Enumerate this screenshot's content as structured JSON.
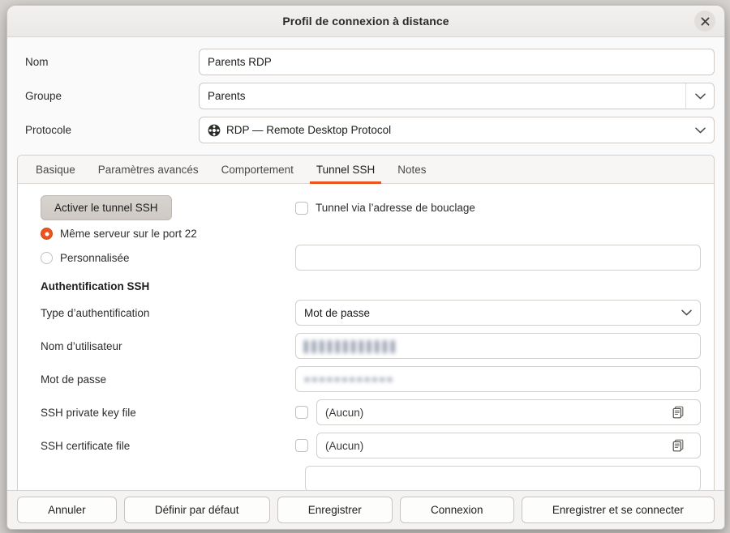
{
  "window": {
    "title": "Profil de connexion à distance",
    "close_icon": "close-icon"
  },
  "accent_color": "#e95420",
  "top_form": {
    "rows": [
      {
        "label": "Nom",
        "value": "Parents RDP",
        "kind": "entry"
      },
      {
        "label": "Groupe",
        "value": "Parents",
        "kind": "combo"
      },
      {
        "label": "Protocole",
        "value": "RDP — Remote Desktop Protocol",
        "kind": "combo",
        "icon": "rdp-protocol-icon"
      }
    ]
  },
  "tabs": [
    {
      "label": "Basique",
      "active": false
    },
    {
      "label": "Paramètres avancés",
      "active": false
    },
    {
      "label": "Comportement",
      "active": false
    },
    {
      "label": "Tunnel SSH",
      "active": true
    },
    {
      "label": "Notes",
      "active": false
    }
  ],
  "ssh_tunnel": {
    "enable_button": "Activer le tunnel SSH",
    "loopback_checkbox": {
      "label": "Tunnel via l’adresse de bouclage",
      "checked": false
    },
    "server_choice": [
      {
        "label": "Même serveur sur le port 22",
        "selected": true
      },
      {
        "label": "Personnalisée",
        "selected": false
      }
    ],
    "custom_server_value": "",
    "auth_section_title": "Authentification SSH",
    "auth_type": {
      "label": "Type d’authentification",
      "value": "Mot de passe"
    },
    "username": {
      "label": "Nom d’utilisateur",
      "value": "▌▌▌▌▌▌▌▌▌▌▌▌",
      "redacted": true
    },
    "password": {
      "label": "Mot de passe",
      "value": "●●●●●●●●●●●●",
      "redacted": true
    },
    "private_key": {
      "label": "SSH private key file",
      "value": "(Aucun)",
      "checked": false,
      "browse_icon": "file-browse-icon"
    },
    "certificate": {
      "label": "SSH certificate file",
      "value": "(Aucun)",
      "checked": false,
      "browse_icon": "file-browse-icon"
    }
  },
  "action_bar": {
    "buttons": [
      {
        "label": "Annuler"
      },
      {
        "label": "Définir par défaut"
      },
      {
        "label": "Enregistrer"
      },
      {
        "label": "Connexion"
      },
      {
        "label": "Enregistrer et se connecter"
      }
    ]
  }
}
